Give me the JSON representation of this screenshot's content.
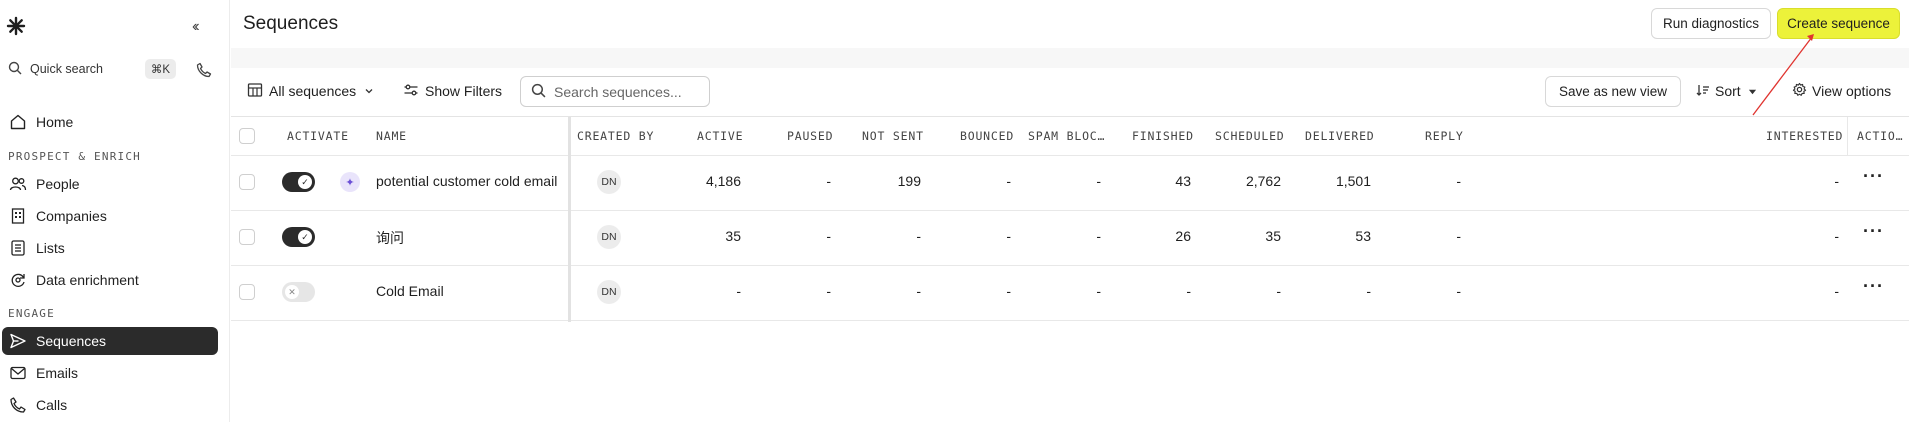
{
  "sidebar": {
    "quick_search": "Quick search",
    "shortcut": "⌘K",
    "sections": {
      "prospect": "PROSPECT & ENRICH",
      "engage": "ENGAGE"
    },
    "items": {
      "home": "Home",
      "people": "People",
      "companies": "Companies",
      "lists": "Lists",
      "data_enrichment": "Data enrichment",
      "sequences": "Sequences",
      "emails": "Emails",
      "calls": "Calls"
    }
  },
  "header": {
    "title": "Sequences",
    "run_diagnostics": "Run diagnostics",
    "create_sequence": "Create sequence"
  },
  "toolbar": {
    "view_select": "All sequences",
    "show_filters": "Show Filters",
    "search_placeholder": "Search sequences...",
    "save_view": "Save as new view",
    "sort": "Sort",
    "view_options": "View options"
  },
  "table": {
    "columns": {
      "activate": "ACTIVATE",
      "name": "NAME",
      "created_by": "CREATED BY",
      "active": "ACTIVE",
      "paused": "PAUSED",
      "not_sent": "NOT SENT",
      "bounced": "BOUNCED",
      "spam_blocked": "SPAM BLOC…",
      "finished": "FINISHED",
      "scheduled": "SCHEDULED",
      "delivered": "DELIVERED",
      "reply": "REPLY",
      "interested": "INTERESTED",
      "actions": "ACTIO…"
    },
    "rows": [
      {
        "active_on": true,
        "ai": true,
        "name": "potential customer cold email",
        "created_by": "DN",
        "active": "4,186",
        "paused": "-",
        "not_sent": "199",
        "bounced": "-",
        "spam_blocked": "-",
        "finished": "43",
        "scheduled": "2,762",
        "delivered": "1,501",
        "reply": "-",
        "interested": "-"
      },
      {
        "active_on": true,
        "ai": false,
        "name": "询问",
        "created_by": "DN",
        "active": "35",
        "paused": "-",
        "not_sent": "-",
        "bounced": "-",
        "spam_blocked": "-",
        "finished": "26",
        "scheduled": "35",
        "delivered": "53",
        "reply": "-",
        "interested": "-"
      },
      {
        "active_on": false,
        "ai": false,
        "name": "Cold Email",
        "created_by": "DN",
        "active": "-",
        "paused": "-",
        "not_sent": "-",
        "bounced": "-",
        "spam_blocked": "-",
        "finished": "-",
        "scheduled": "-",
        "delivered": "-",
        "reply": "-",
        "interested": "-"
      }
    ]
  },
  "colors": {
    "accent": "#ecf23a",
    "active_nav": "#2b2b2b",
    "annotation_arrow": "#e0342f"
  }
}
